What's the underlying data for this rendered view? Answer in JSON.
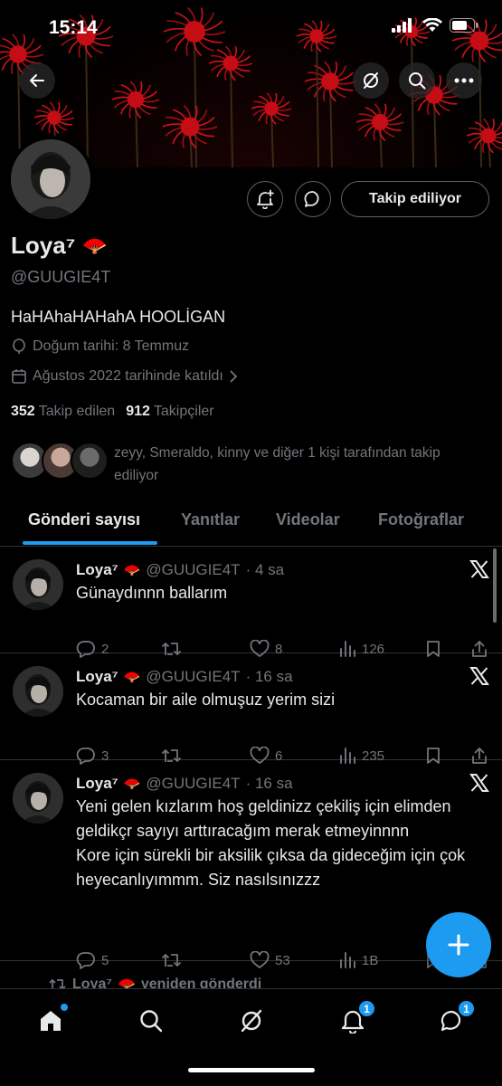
{
  "status_bar": {
    "time": "15:14"
  },
  "profile": {
    "name": "Loya⁷",
    "name_emoji": "🪭",
    "handle": "@GUUGIE4T",
    "bio": "HaHAhaHAHahA HOOLİGAN",
    "birthday": "Doğum tarihi: 8 Temmuz",
    "joined": "Ağustos 2022 tarihinde katıldı",
    "following_count": "352",
    "following_label": "Takip edilen",
    "followers_count": "912",
    "followers_label": "Takipçiler",
    "followed_by": "zeyy, Smeraldo, kinny ve diğer 1 kişi tarafından takip ediliyor",
    "follow_button": "Takip ediliyor"
  },
  "tabs": [
    {
      "label": "Gönderi sayısı",
      "active": true
    },
    {
      "label": "Yanıtlar",
      "active": false
    },
    {
      "label": "Videolar",
      "active": false
    },
    {
      "label": "Fotoğraflar",
      "active": false
    }
  ],
  "posts": [
    {
      "name": "Loya⁷",
      "emoji": "🪭",
      "handle": "@GUUGIE4T",
      "time": "· 4 sa",
      "text": "Günaydınnn ballarım",
      "replies": "2",
      "reposts": "",
      "likes": "8",
      "views": "126"
    },
    {
      "name": "Loya⁷",
      "emoji": "🪭",
      "handle": "@GUUGIE4T",
      "time": "· 16 sa",
      "text": "Kocaman bir aile olmuşuz yerim sizi",
      "replies": "3",
      "reposts": "",
      "likes": "6",
      "views": "235"
    },
    {
      "name": "Loya⁷",
      "emoji": "🪭",
      "handle": "@GUUGIE4T",
      "time": "· 16 sa",
      "text": "Yeni gelen kızlarım hoş geldinizz çekiliş için elimden geldikçr sayıyı arttıracağım merak etmeyinnnn\nKore için sürekli bir aksilik çıksa da gideceğim için çok heyecanlıyımmm. Siz nasılsınızzz",
      "replies": "5",
      "reposts": "",
      "likes": "53",
      "views": "1B"
    }
  ],
  "repost_banner": {
    "name": "Loya⁷",
    "emoji": "🪭",
    "label": "yeniden gönderdi"
  },
  "bottom_nav": {
    "notifications_badge": "1",
    "messages_badge": "1"
  },
  "colors": {
    "accent": "#1d9bf0",
    "muted": "#71767b",
    "text": "#e7e9ea",
    "border": "#2f3336"
  }
}
